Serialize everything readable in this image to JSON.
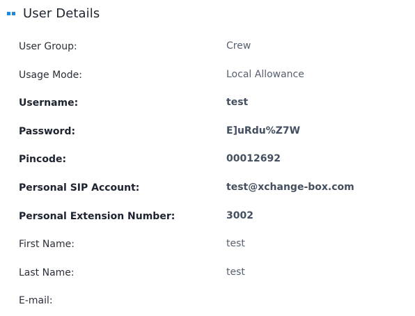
{
  "header": {
    "title": "User Details",
    "icon": "drag-handle-icon",
    "accent": "#1e88e5"
  },
  "details": {
    "rows": [
      {
        "label": "User Group:",
        "value": "Crew"
      },
      {
        "label": "Usage Mode:",
        "value": "Local Allowance"
      },
      {
        "label": "Username:",
        "value": "test"
      },
      {
        "label": "Password:",
        "value": "E]uRdu%Z7W"
      },
      {
        "label": "Pincode:",
        "value": "00012692"
      },
      {
        "label": "Personal SIP Account:",
        "value": "test@xchange-box.com"
      },
      {
        "label": "Personal Extension Number:",
        "value": "3002"
      },
      {
        "label": "First Name:",
        "value": "test"
      },
      {
        "label": "Last Name:",
        "value": "test"
      },
      {
        "label": "E-mail:",
        "value": ""
      }
    ]
  }
}
